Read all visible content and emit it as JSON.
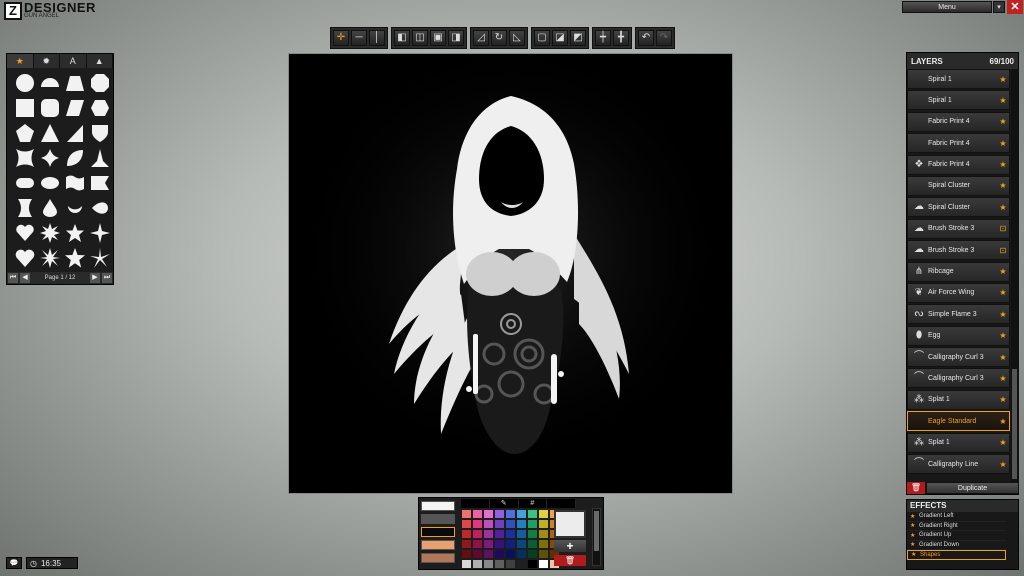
{
  "app": {
    "logo": "Z",
    "title": "DESIGNER",
    "subtitle": "GUN ANGEL"
  },
  "window_controls": {
    "menu_label": "Menu",
    "menu_arrow_icon": "chevron-down-icon",
    "close_icon": "close-icon"
  },
  "toolbar": {
    "groups": [
      [
        "move-icon",
        "flip-horizontal-icon",
        "flip-vertical-icon"
      ],
      [
        "align-left-icon",
        "align-center-icon",
        "align-top-icon",
        "align-right-icon"
      ],
      [
        "skew-icon",
        "rotate-icon",
        "scale-icon"
      ],
      [
        "layer-front-icon",
        "layer-forward-icon",
        "layer-back-icon"
      ],
      [
        "center-horizontal-icon",
        "center-vertical-icon"
      ],
      [
        "undo-icon",
        "redo-icon"
      ]
    ]
  },
  "shapes_panel": {
    "tabs": [
      "★",
      "✹",
      "A",
      "▲"
    ],
    "tab_icons": [
      "favorites-icon",
      "burst-icon",
      "text-icon",
      "folder-icon"
    ],
    "page_label": "Page 1 / 12",
    "shapes": [
      "circle",
      "semicircle",
      "trapezoid",
      "octagon",
      "square",
      "rounded-square",
      "parallelogram",
      "hexagon",
      "pentagon",
      "triangle",
      "right-triangle",
      "shield",
      "concave-square",
      "concave-diamond",
      "leaf",
      "spike-triangle",
      "pill",
      "oval",
      "wave-flag",
      "ribbon-flag",
      "hourglass",
      "drop",
      "crescent",
      "lemon",
      "heart",
      "starburst",
      "star",
      "sharp-star",
      "heart-filled",
      "seal-burst",
      "star-5",
      "pinwheel-star"
    ]
  },
  "canvas": {
    "artwork": "gun-angel-artwork"
  },
  "palette": {
    "tabs": [
      "",
      "✎",
      "#",
      ""
    ],
    "swatches": [
      "#f4f4f4",
      "#555555",
      "#0a0a0a",
      "#e8a070",
      "#b07858"
    ],
    "colors": [
      "#f07070",
      "#f060a0",
      "#e070d0",
      "#9060e0",
      "#5070e0",
      "#40a0e0",
      "#40c080",
      "#e0d040",
      "#f0a040",
      "#e04848",
      "#e03880",
      "#c050c0",
      "#7040c0",
      "#3050c0",
      "#2080c0",
      "#20a060",
      "#c0b020",
      "#d08020",
      "#c02828",
      "#c02060",
      "#a030a0",
      "#5020a0",
      "#1830a0",
      "#1060a0",
      "#108040",
      "#a09010",
      "#b06010",
      "#901818",
      "#901048",
      "#801880",
      "#381080",
      "#102080",
      "#084880",
      "#086030",
      "#807008",
      "#884808",
      "#601010",
      "#600830",
      "#601060",
      "#200860",
      "#081060",
      "#043060",
      "#044020",
      "#605004",
      "#603004",
      "#d8d8d8",
      "#b0b0b0",
      "#888888",
      "#606060",
      "#404040",
      "#202020",
      "#000000",
      "#ffffff",
      "#e8c8a8"
    ],
    "add_label": "+",
    "delete_icon": "trash-icon"
  },
  "layers": {
    "title": "LAYERS",
    "count": "69/100",
    "items": [
      {
        "name": "Spiral 1",
        "icon": "",
        "star": "★"
      },
      {
        "name": "Spiral 1",
        "icon": "",
        "star": "★"
      },
      {
        "name": "Fabric Print 4",
        "icon": "",
        "star": "★"
      },
      {
        "name": "Fabric Print 4",
        "icon": "",
        "star": "★"
      },
      {
        "name": "Fabric Print 4",
        "icon": "❖",
        "star": "★"
      },
      {
        "name": "Spiral Cluster",
        "icon": "",
        "star": "★"
      },
      {
        "name": "Spiral Cluster",
        "icon": "☁",
        "star": "★"
      },
      {
        "name": "Brush Stroke 3",
        "icon": "☁",
        "star": "⊡"
      },
      {
        "name": "Brush Stroke 3",
        "icon": "☁",
        "star": "⊡"
      },
      {
        "name": "Ribcage",
        "icon": "⋔",
        "star": "★"
      },
      {
        "name": "Air Force Wing",
        "icon": "❦",
        "star": "★"
      },
      {
        "name": "Simple Flame 3",
        "icon": "ᔓ",
        "star": "★"
      },
      {
        "name": "Egg",
        "icon": "⬮",
        "star": "★"
      },
      {
        "name": "Calligraphy Curl 3",
        "icon": "⌒",
        "star": "★"
      },
      {
        "name": "Calligraphy Curl 3",
        "icon": "⌒",
        "star": "★"
      },
      {
        "name": "Splat 1",
        "icon": "⁂",
        "star": "★"
      },
      {
        "name": "Eagle Standard",
        "icon": "",
        "star": "★",
        "selected": true
      },
      {
        "name": "Splat 1",
        "icon": "⁂",
        "star": "★"
      },
      {
        "name": "Calligraphy Line",
        "icon": "⌒",
        "star": "★"
      }
    ],
    "delete_icon": "trash-icon",
    "duplicate_label": "Duplicate"
  },
  "effects": {
    "title": "EFFECTS",
    "items": [
      {
        "name": "Gradient Left"
      },
      {
        "name": "Gradient Right"
      },
      {
        "name": "Gradient Up"
      },
      {
        "name": "Gradient Down"
      },
      {
        "name": "Shapes",
        "selected": true
      }
    ]
  },
  "footer": {
    "chat_icon": "chat-icon",
    "clock_icon": "clock-icon",
    "time": "16:35"
  }
}
